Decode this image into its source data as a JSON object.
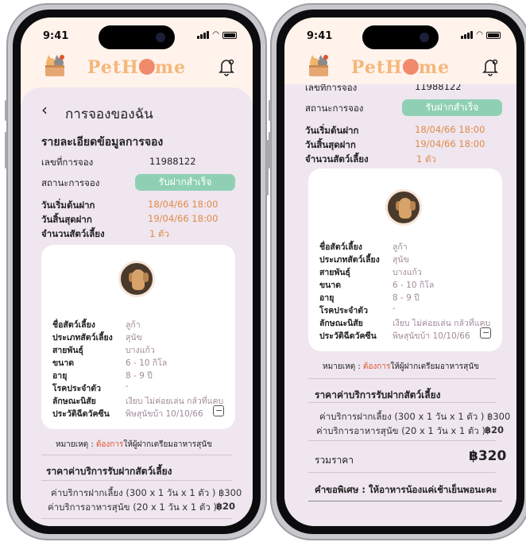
{
  "status_bar": {
    "time": "9:41"
  },
  "brand": {
    "name_pre": "PetH",
    "name_post": "me"
  },
  "page": {
    "title": "การจองของฉัน"
  },
  "details": {
    "heading": "รายละเอียดข้อมูลการจอง",
    "booking_no_label": "เลขที่การจอง",
    "booking_no": "11988122",
    "status_label": "สถานะการจอง",
    "status": "รับฝากสำเร็จ",
    "start_label": "วันเริ่มต้นฝาก",
    "start": "18/04/66 18:00",
    "end_label": "วันสิ้นสุดฝาก",
    "end": "19/04/66 18:00",
    "count_label": "จำนวนสัตว์เลี้ยง",
    "count": "1 ตัว"
  },
  "pet": {
    "name_label": "ชื่อสัตว์เลี้ยง",
    "name": "ลูก้า",
    "type_label": "ประเภทสัตว์เลี้ยง",
    "type": "สุนัข",
    "breed_label": "สายพันธุ์",
    "breed": "บางแก้ว",
    "size_label": "ขนาด",
    "size": "6 - 10 กิโล",
    "age_label": "อายุ",
    "age": "8 - 9 ปี",
    "disease_label": "โรคประจำตัว",
    "disease": "-",
    "trait_label": "ลักษณะนิสัย",
    "trait": "เงียบ ไม่ค่อยเล่น กลัวที่แคบ",
    "vaccine_label": "ประวัติฉีดวัคซีน",
    "vaccine": "พิษสุนัขบ้า  10/10/66"
  },
  "note": {
    "prefix": "หมายเหตุ : ",
    "highlight": "ต้องการ",
    "rest": "ให้ผู้ฝากเตรียมอาหารสุนัข"
  },
  "pricing": {
    "heading": "ราคาค่าบริการรับฝากสัตว์เลี้ยง",
    "line1": "ค่าบริการฝากเลี้ยง (300 x 1 วัน x 1 ตัว ) ฿300",
    "line2_label": "ค่าบริการอาหารสุนัข (20 x 1 วัน x 1 ตัว )",
    "line2_value": "฿20",
    "total_label": "รวมราคา",
    "total": "฿320"
  },
  "special": {
    "text": "คำขอพิเศษ : ให้อาหารน้องแค่เช้าเย็นพอนะคะ"
  },
  "colors": {
    "accent_green": "#8fd0b4",
    "orange": "#e08a4a",
    "brand": "#f5b77a"
  }
}
